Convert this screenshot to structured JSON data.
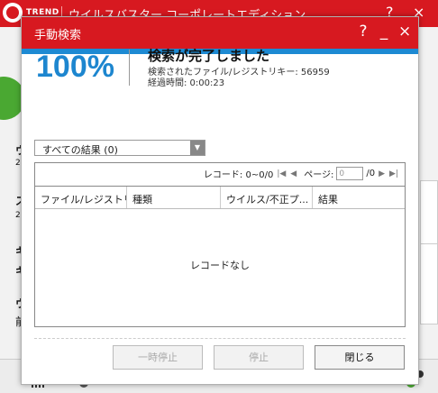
{
  "background": {
    "brand": "TREND",
    "title": "ウイルスバスター コーポレートエディション",
    "controls": [
      "?",
      "×"
    ]
  },
  "dialog": {
    "title": "手動検索",
    "controls": {
      "help": "?",
      "minimize": "_",
      "close": "×"
    }
  },
  "progress": {
    "percent_label": "100%",
    "percent_value": 1.0,
    "status_title": "検索が完了しました",
    "scanned_label": "検索されたファイル/レジストリキー: 56959",
    "elapsed_label": "経過時間: 0:00:23"
  },
  "filter": {
    "selected": "すべての結果 (0)"
  },
  "pager": {
    "records": "レコード: 0~0/0",
    "page_label": "ページ:",
    "page_value": "0",
    "page_total": "/0",
    "first": "|◀",
    "prev": "◀",
    "next": "▶",
    "last": "▶|"
  },
  "table": {
    "columns": [
      "ファイル/レジストリ...",
      "種類",
      "ウイルス/不正プ...",
      "結果"
    ],
    "empty_message": "レコードなし"
  },
  "buttons": {
    "pause": "一時停止",
    "stop": "停止",
    "close": "閉じる"
  },
  "colors": {
    "titlebar": "#d71920",
    "accent_blue": "#1d86cf"
  },
  "icons": [
    "app-logo-icon",
    "chart-icon",
    "settings-gear-icon",
    "network-status-icon"
  ]
}
